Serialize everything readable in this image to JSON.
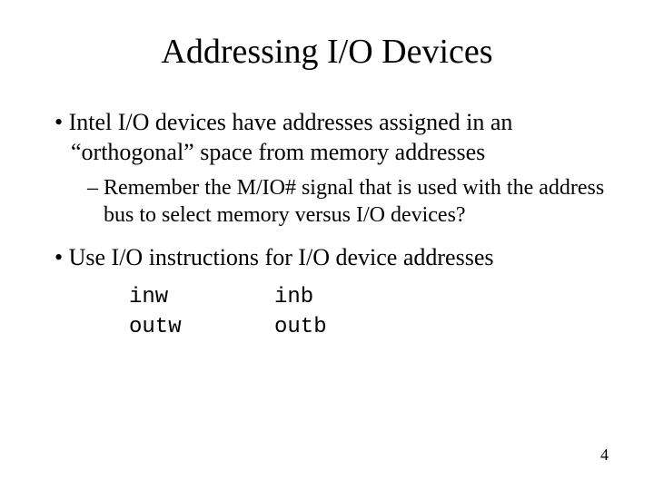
{
  "title": "Addressing I/O Devices",
  "bullets": [
    "Intel I/O devices have addresses assigned in an “orthogonal” space from memory addresses",
    "Use I/O instructions for I/O device addresses"
  ],
  "dash": "Remember the M/IO# signal that is used with the address bus to select memory versus I/O devices?",
  "code": {
    "r0c0": "inw",
    "r0c1": "inb",
    "r1c0": "outw",
    "r1c1": "outb"
  },
  "page_number": "4"
}
